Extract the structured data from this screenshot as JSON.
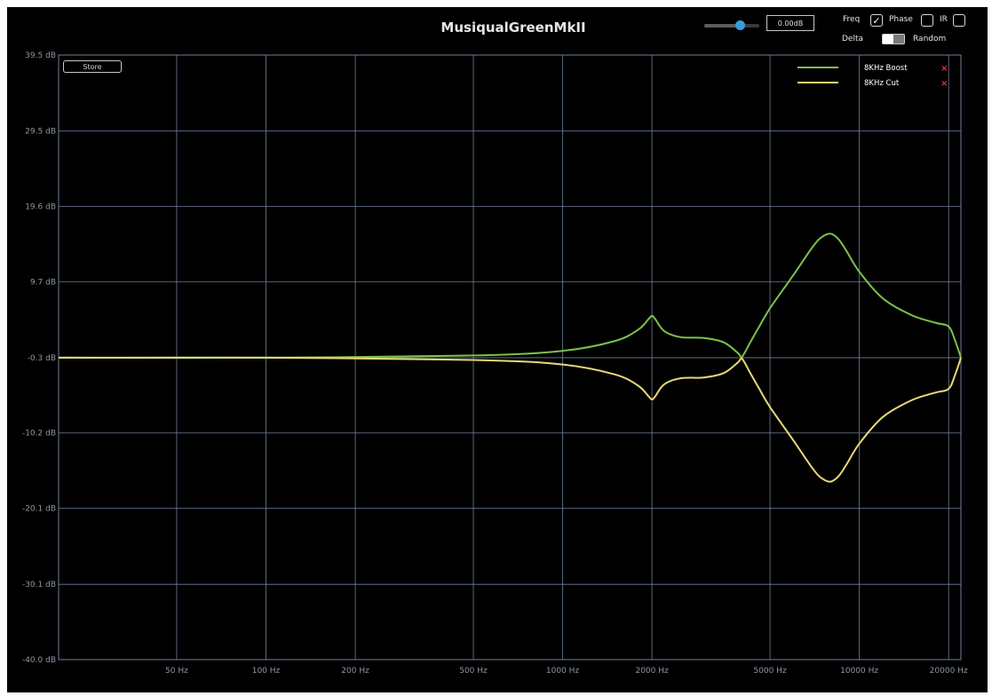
{
  "window": {
    "title": "MusiqualGreenMkII"
  },
  "controls": {
    "gain_value": "0.00dB",
    "gain_slider_level": 0.64,
    "store_label": "Store",
    "freq": {
      "label": "Freq",
      "checked": true
    },
    "phase": {
      "label": "Phase",
      "checked": false
    },
    "ir": {
      "label": "IR",
      "checked": false
    },
    "delta_label": "Delta",
    "random_label": "Random",
    "delta_random_state": "Delta"
  },
  "chart_data": {
    "type": "line",
    "xscale": "log",
    "xlim": [
      20,
      22000
    ],
    "ylim": [
      -40.0,
      39.5
    ],
    "grid": true,
    "y_ticks": [
      "39.5 dB",
      "29.5 dB",
      "19.6 dB",
      "9.7 dB",
      "-0.3 dB",
      "-10.2 dB",
      "-20.1 dB",
      "-30.1 dB",
      "-40.0 dB"
    ],
    "y_tick_values": [
      39.5,
      29.5,
      19.6,
      9.7,
      -0.3,
      -10.2,
      -20.1,
      -30.1,
      -40.0
    ],
    "x_ticks": [
      "50 Hz",
      "100 Hz",
      "200 Hz",
      "500 Hz",
      "1000 Hz",
      "2000 Hz",
      "5000 Hz",
      "10000 Hz",
      "20000 Hz"
    ],
    "x_tick_values": [
      50,
      100,
      200,
      500,
      1000,
      2000,
      5000,
      10000,
      20000
    ],
    "legend_position": "top-right",
    "series": [
      {
        "name": "8KHz Boost",
        "color": "#7cc24a",
        "x": [
          20,
          100,
          500,
          1000,
          1500,
          1800,
          1950,
          2000,
          2050,
          2200,
          2500,
          3000,
          3500,
          3900,
          4000,
          4100,
          4300,
          4600,
          5000,
          6000,
          7000,
          7500,
          8000,
          8500,
          9000,
          10000,
          12000,
          15000,
          18000,
          20000,
          21000,
          22000
        ],
        "y": [
          -0.3,
          -0.3,
          0.0,
          0.6,
          1.9,
          3.4,
          4.8,
          5.2,
          4.8,
          3.2,
          2.4,
          2.3,
          1.7,
          0.3,
          -0.2,
          0.3,
          1.8,
          3.8,
          6.2,
          10.6,
          14.4,
          15.6,
          16.0,
          15.3,
          13.9,
          11.0,
          7.5,
          5.3,
          4.3,
          3.8,
          2.0,
          -0.3
        ]
      },
      {
        "name": "8KHz Cut",
        "color": "#e8d878",
        "x": [
          20,
          100,
          500,
          1000,
          1500,
          1800,
          1950,
          2000,
          2050,
          2200,
          2500,
          3000,
          3500,
          3900,
          4000,
          4100,
          4300,
          4600,
          5000,
          6000,
          7000,
          7500,
          8000,
          8500,
          9000,
          10000,
          12000,
          15000,
          18000,
          20000,
          21000,
          22000
        ],
        "y": [
          -0.3,
          -0.3,
          -0.6,
          -1.2,
          -2.5,
          -4.0,
          -5.4,
          -5.8,
          -5.4,
          -3.8,
          -3.0,
          -2.9,
          -2.3,
          -0.9,
          -0.4,
          -0.9,
          -2.4,
          -4.4,
          -6.8,
          -11.2,
          -15.0,
          -16.2,
          -16.6,
          -15.9,
          -14.5,
          -11.6,
          -8.1,
          -5.9,
          -4.9,
          -4.4,
          -2.6,
          -0.3
        ]
      }
    ]
  }
}
